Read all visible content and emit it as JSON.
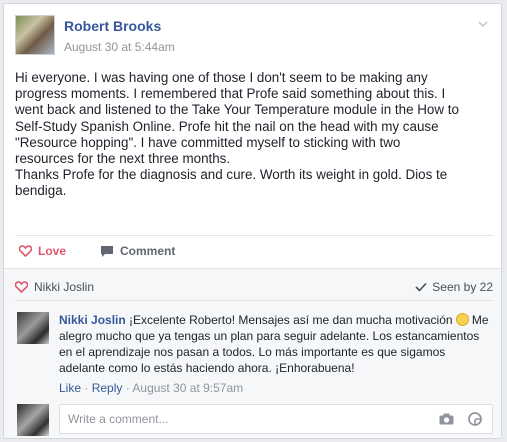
{
  "post": {
    "author": "Robert Brooks",
    "timestamp": "August 30 at 5:44am",
    "body": "Hi everyone. I was having one of those I don't seem to be making any\nprogress moments. I remembered that Profe said something about this. I\nwent back and listened to the Take Your Temperature module in the How to\nSelf-Study Spanish Online. Profe hit the nail on the head with my cause\n\"Resource hopping\". I have committed myself to sticking with two\nresources for the next three months.\nThanks Profe for the diagnosis and cure. Worth its weight in gold. Dios te\nbendiga."
  },
  "actions": {
    "love": "Love",
    "comment": "Comment"
  },
  "reactions": {
    "liker": "Nikki Joslin",
    "seen_by": "Seen by 22"
  },
  "comment": {
    "author": "Nikki Joslin",
    "text": "¡Excelente Roberto! Mensajes así me dan mucha motivación",
    "text2": "Me alegro mucho que ya tengas un plan para seguir adelante. Los estancamientos en el aprendizaje nos pasan a todos. Lo más importante es que sigamos adelante como lo estás haciendo ahora. ¡Enhorabuena!",
    "like": "Like",
    "reply": "Reply",
    "separator": "·",
    "time": "August 30 at 9:57am"
  },
  "composer": {
    "placeholder": "Write a comment..."
  },
  "colors": {
    "link": "#365899",
    "love": "#e0566b",
    "muted": "#90949c"
  },
  "icons": [
    "chevron-down-icon",
    "heart-icon",
    "comment-icon",
    "checkmark-icon",
    "smiley-icon",
    "camera-icon",
    "sticker-icon"
  ]
}
